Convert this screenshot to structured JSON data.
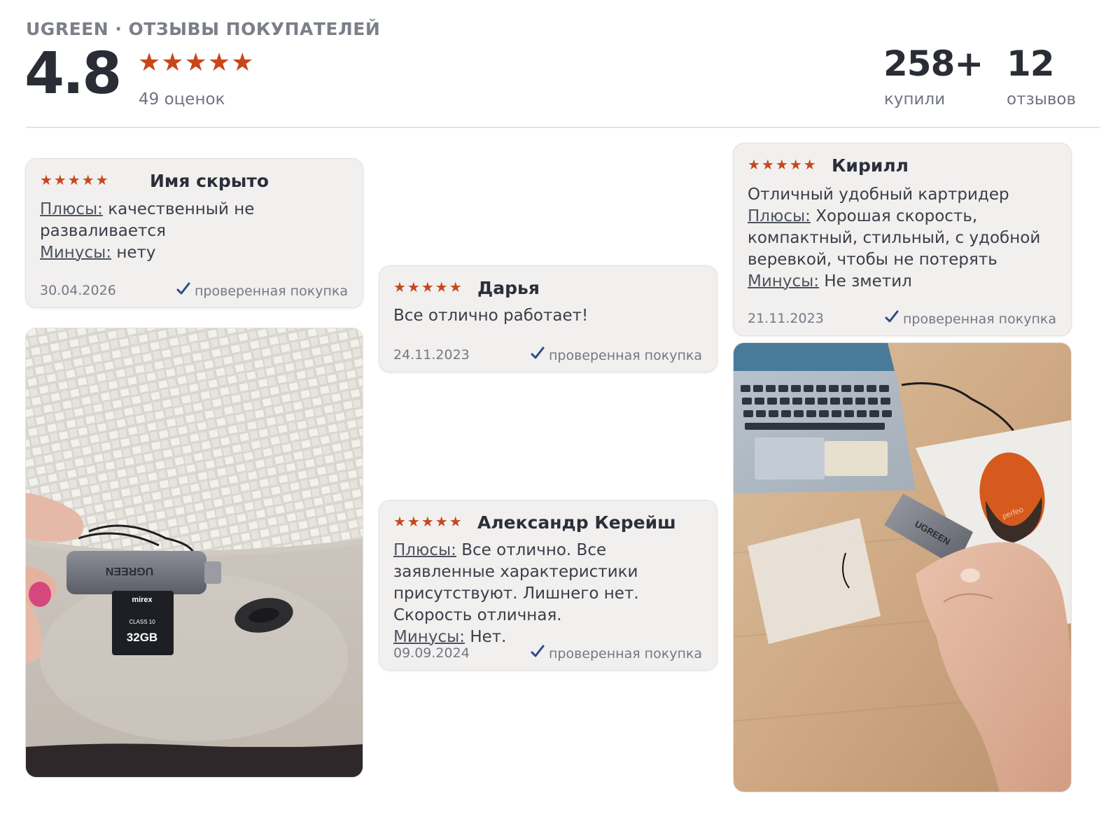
{
  "header": {
    "kicker": "UGREEN · ОТЗЫВЫ ПОКУПАТЕЛЕЙ",
    "rating": "4.8",
    "stars": "★★★★★",
    "votes": "49 оценок",
    "bought_count": "258+",
    "bought_label": "купили",
    "reviews_count": "12",
    "reviews_label": "отзывов"
  },
  "colors": {
    "accent_star": "#c8471a",
    "check": "#2f4a8a",
    "card_bg": "#f1f0ef"
  },
  "reviews": [
    {
      "stars": "★★★★★",
      "author": "Имя скрыто",
      "pros_label": "Плюсы:",
      "pros": "качественный не разваливается",
      "cons_label": "Минусы:",
      "cons": "нету",
      "date": "30.04.2026",
      "verified": "проверенная покупка"
    },
    {
      "stars": "★★★★★",
      "author": "Дарья",
      "text": "Все отлично работает!",
      "date": "24.11.2023",
      "verified": "проверенная покупка"
    },
    {
      "stars": "★★★★★",
      "author": "Александр Керейш",
      "pros_label": "Плюсы:",
      "pros": "Все отлично. Все заявленные характеристики присутствуют. Лишнего нет. Скорость отличная.",
      "cons_label": "Минусы:",
      "cons": "Нет.",
      "date": "09.09.2024",
      "verified": "проверенная покупка"
    },
    {
      "stars": "★★★★★",
      "author": "Кирилл",
      "text": "Отличный удобный картридер",
      "pros_label": "Плюсы:",
      "pros": "Хорошая скорость, компактный, стильный, с удобной веревкой, чтобы не потерять",
      "cons_label": "Минусы:",
      "cons": "Не зметил",
      "date": "21.11.2023",
      "verified": "проверенная покупка"
    }
  ],
  "photos": {
    "left": {
      "reader_brand": "UGREEN",
      "sd_brand": "mirex",
      "sd_class": "CLASS 10",
      "sd_capacity": "32GB"
    },
    "right": {
      "reader_brand": "UGREEN",
      "mouse_brand": "perfeo"
    }
  }
}
